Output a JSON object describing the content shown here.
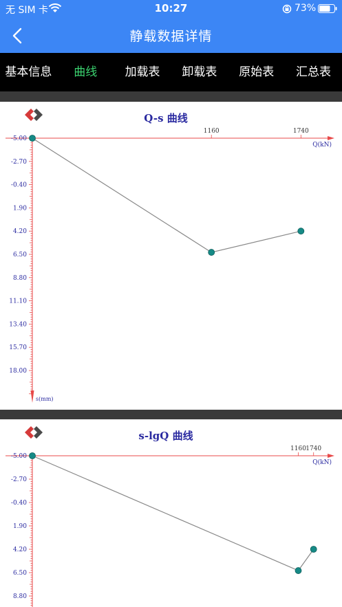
{
  "status_bar": {
    "carrier": "无 SIM 卡",
    "time": "10:27",
    "battery": "73%"
  },
  "header": {
    "title": "静载数据详情"
  },
  "tabs": [
    {
      "label": "基本信息",
      "active": false
    },
    {
      "label": "曲线",
      "active": true
    },
    {
      "label": "加载表",
      "active": false
    },
    {
      "label": "卸载表",
      "active": false
    },
    {
      "label": "原始表",
      "active": false
    },
    {
      "label": "汇总表",
      "active": false
    }
  ],
  "colors": {
    "header": "#3c86f5",
    "tab_active": "#3bd16f",
    "axis": "#e84a4a",
    "point": "#168a86",
    "line": "#888888",
    "title": "#2a2aa0"
  },
  "icons": {
    "back": "chevron-left-icon",
    "logo": "brand-logo-icon"
  },
  "chart_data": [
    {
      "type": "line",
      "title": "Q-s 曲线",
      "xlabel": "Q(kN)",
      "ylabel": "s(mm)",
      "x_ticks": [
        "1160",
        "1740"
      ],
      "x_tick_values": [
        1160,
        1740
      ],
      "xlim": [
        0,
        1850
      ],
      "y_ticks": [
        "-5.00",
        "-2.70",
        "-0.40",
        "1.90",
        "4.20",
        "6.50",
        "8.80",
        "11.10",
        "13.40",
        "15.70",
        "18.00"
      ],
      "ylim": [
        -5.0,
        20.3
      ],
      "y_inverted": true,
      "x": [
        0,
        1160,
        1740
      ],
      "y": [
        -5.0,
        6.3,
        4.2
      ]
    },
    {
      "type": "line",
      "title": "s-lgQ 曲线",
      "xlabel": "Q(kN)",
      "x_ticks": [
        "1160",
        "1740"
      ],
      "x_tick_values": [
        1160,
        1740
      ],
      "x_scale": "log",
      "xlim": [
        1,
        2100
      ],
      "y_ticks": [
        "-5.00",
        "-2.70",
        "-0.40",
        "1.90",
        "4.20",
        "6.50",
        "8.80"
      ],
      "ylim": [
        -5.0,
        9.6
      ],
      "y_inverted": true,
      "x": [
        1,
        1160,
        1740
      ],
      "y": [
        -5.0,
        6.3,
        4.2
      ]
    }
  ]
}
